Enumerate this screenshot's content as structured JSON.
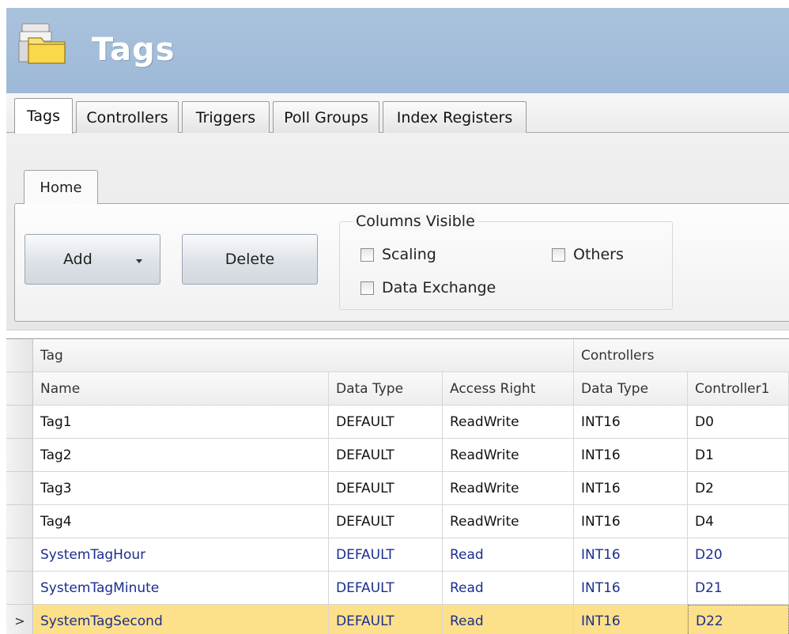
{
  "header": {
    "title": "Tags",
    "icon": "tags-folder-icon"
  },
  "tabs": [
    {
      "label": "Tags",
      "active": true
    },
    {
      "label": "Controllers",
      "active": false
    },
    {
      "label": "Triggers",
      "active": false
    },
    {
      "label": "Poll Groups",
      "active": false
    },
    {
      "label": "Index Registers",
      "active": false
    }
  ],
  "ribbon": {
    "tab": "Home",
    "add_label": "Add",
    "delete_label": "Delete",
    "columns_visible": {
      "title": "Columns Visible",
      "scaling": "Scaling",
      "others": "Others",
      "data_exchange": "Data Exchange"
    }
  },
  "grid": {
    "group_headers": {
      "tag": "Tag",
      "controllers": "Controllers"
    },
    "columns": [
      "Name",
      "Data Type",
      "Access Right",
      "Data Type",
      "Controller1"
    ],
    "rows": [
      [
        "Tag1",
        "DEFAULT",
        "ReadWrite",
        "INT16",
        "D0"
      ],
      [
        "Tag2",
        "DEFAULT",
        "ReadWrite",
        "INT16",
        "D1"
      ],
      [
        "Tag3",
        "DEFAULT",
        "ReadWrite",
        "INT16",
        "D2"
      ],
      [
        "Tag4",
        "DEFAULT",
        "ReadWrite",
        "INT16",
        "D4"
      ],
      [
        "SystemTagHour",
        "DEFAULT",
        "Read",
        "INT16",
        "D20"
      ],
      [
        "SystemTagMinute",
        "DEFAULT",
        "Read",
        "INT16",
        "D21"
      ],
      [
        "SystemTagSecond",
        "DEFAULT",
        "Read",
        "INT16",
        "D22"
      ]
    ],
    "selected_indicator": ">",
    "colors": {
      "system_text": "#1c2e8c",
      "selected_row": "#fde08a"
    }
  }
}
